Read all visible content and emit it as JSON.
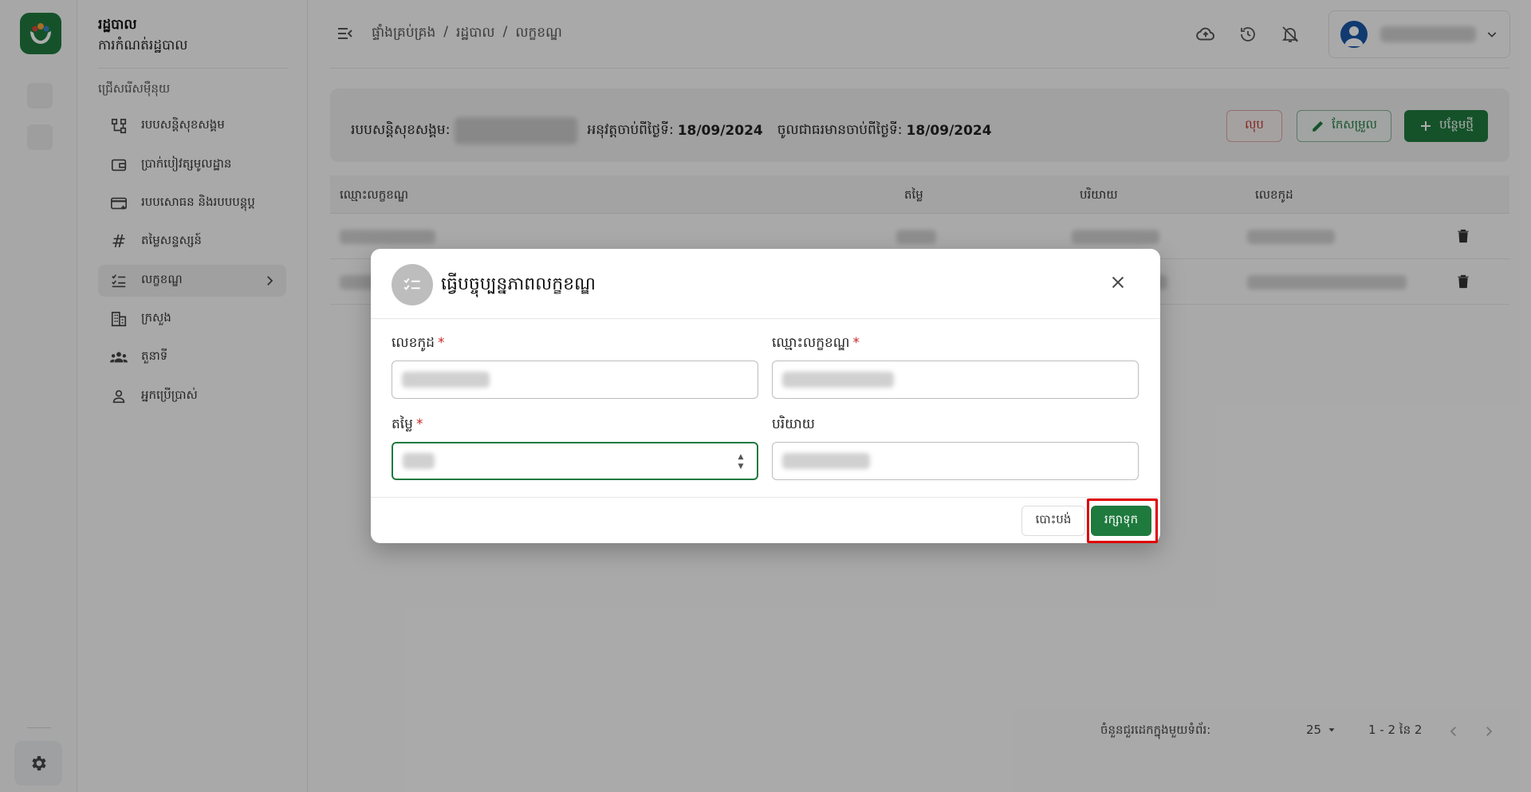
{
  "app": {
    "title": "រដ្ឋបាល",
    "subtitle": "ការកំណត់រដ្ឋបាល",
    "section_label": "ជ្រើសរើសម៉ឺនុយ"
  },
  "sidebar": {
    "items": [
      {
        "label": "របបសន្តិសុខសង្គម",
        "icon": "hierarchy-icon"
      },
      {
        "label": "ប្រាក់បៀវត្សមូលដ្ឋាន",
        "icon": "wallet-icon"
      },
      {
        "label": "របបសោធន និងរបបបន្តុប្ត",
        "icon": "card-icon"
      },
      {
        "label": "តម្លៃសន្ទស្សន៍",
        "icon": "hash-icon"
      },
      {
        "label": "លក្ខខណ្ឌ",
        "icon": "checklist-icon",
        "active": true
      },
      {
        "label": "ក្រសួង",
        "icon": "building-icon"
      },
      {
        "label": "តួនាទី",
        "icon": "group-icon"
      },
      {
        "label": "អ្នកប្រើប្រាស់",
        "icon": "person-icon"
      }
    ]
  },
  "breadcrumb": [
    "ផ្ទាំងគ្រប់គ្រង",
    "/",
    "រដ្ឋបាល",
    "/",
    "លក្ខខណ្ឌ"
  ],
  "header_card": {
    "scheme_label": "របបសន្តិសុខសង្គម:",
    "effective_label": "អនុវត្តចាប់ពីថ្ងៃទី:",
    "effective_date": "18/09/2024",
    "enforce_label": "ចូលជាធរមានចាប់ពីថ្ងៃទី:",
    "enforce_date": "18/09/2024",
    "delete_label": "លុប",
    "edit_label": "កែសម្រួល",
    "add_label": "បន្ថែមថ្មី"
  },
  "table": {
    "headers": [
      "ឈ្មោះលក្ខខណ្ឌ",
      "តម្លៃ",
      "បរិយាយ",
      "លេខកូដ"
    ]
  },
  "pagination": {
    "rows_label": "ចំនួនជួរដេកក្នុងមួយទំព័រ:",
    "rows_value": "25",
    "range": "1 - 2 នៃ 2"
  },
  "modal": {
    "title": "ធ្វើបច្ចុប្បន្នភាពលក្ខខណ្ឌ",
    "code_label": "លេខកូដ",
    "name_label": "ឈ្មោះលក្ខខណ្ឌ",
    "value_label": "តម្លៃ",
    "desc_label": "បរិយាយ",
    "required_mark": "*",
    "cancel_label": "បោះបង់",
    "save_label": "រក្សាទុក"
  },
  "colors": {
    "brand": "#1f7a3e",
    "danger": "#c62828",
    "highlight": "#e00000"
  }
}
